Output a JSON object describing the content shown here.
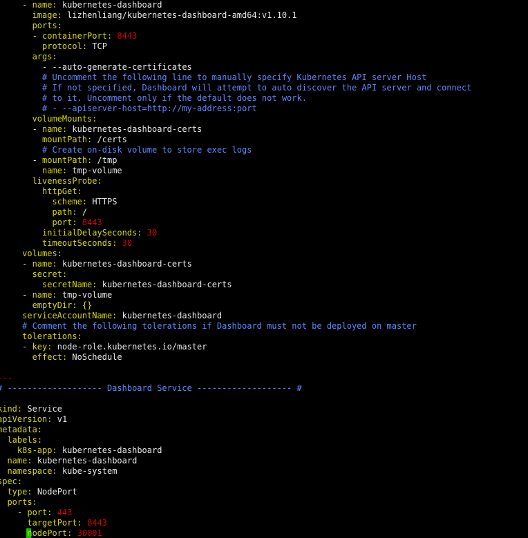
{
  "app": {
    "title": "Terminal - kubernetes-dashboard.yaml"
  },
  "colors": {
    "background": "#000000",
    "key": "#d7d700",
    "text": "#e8e8e8",
    "number": "#d70000",
    "comment": "#5f87ff",
    "cursor": "#00d700"
  },
  "editor": {
    "lines": [
      {
        "indent": "     ",
        "dash": "- ",
        "key": "name",
        "value": "kubernetes-dashboard",
        "type": "text"
      },
      {
        "indent": "       ",
        "key": "image",
        "value": "lizhenliang/kubernetes-dashboard-amd64:v1.10.1",
        "type": "text"
      },
      {
        "indent": "       ",
        "key": "ports",
        "value": "",
        "type": "text"
      },
      {
        "indent": "       ",
        "dash": "- ",
        "key": "containerPort",
        "value": "8443",
        "type": "num"
      },
      {
        "indent": "         ",
        "key": "protocol",
        "value": "TCP",
        "type": "text"
      },
      {
        "indent": "       ",
        "key": "args",
        "value": "",
        "type": "text"
      },
      {
        "indent": "         ",
        "dash": "- ",
        "value": "--auto-generate-certificates",
        "type": "text"
      },
      {
        "indent": "         ",
        "comment": "# Uncomment the following line to manually specify Kubernetes API server Host"
      },
      {
        "indent": "         ",
        "comment": "# If not specified, Dashboard will attempt to auto discover the API server and connect"
      },
      {
        "indent": "         ",
        "comment": "# to it. Uncomment only if the default does not work."
      },
      {
        "indent": "         ",
        "comment": "# - --apiserver-host=http://my-address:port"
      },
      {
        "indent": "       ",
        "key": "volumeMounts",
        "value": "",
        "type": "text"
      },
      {
        "indent": "       ",
        "dash": "- ",
        "key": "name",
        "value": "kubernetes-dashboard-certs",
        "type": "text"
      },
      {
        "indent": "         ",
        "key": "mountPath",
        "value": "/certs",
        "type": "text"
      },
      {
        "indent": "         ",
        "comment": "# Create on-disk volume to store exec logs"
      },
      {
        "indent": "       ",
        "dash": "- ",
        "key": "mountPath",
        "value": "/tmp",
        "type": "text"
      },
      {
        "indent": "         ",
        "key": "name",
        "value": "tmp-volume",
        "type": "text"
      },
      {
        "indent": "       ",
        "key": "livenessProbe",
        "value": "",
        "type": "text"
      },
      {
        "indent": "         ",
        "key": "httpGet",
        "value": "",
        "type": "text"
      },
      {
        "indent": "           ",
        "key": "scheme",
        "value": "HTTPS",
        "type": "text"
      },
      {
        "indent": "           ",
        "key": "path",
        "value": "/",
        "type": "text"
      },
      {
        "indent": "           ",
        "key": "port",
        "value": "8443",
        "type": "num"
      },
      {
        "indent": "         ",
        "key": "initialDelaySeconds",
        "value": "30",
        "type": "num"
      },
      {
        "indent": "         ",
        "key": "timeoutSeconds",
        "value": "30",
        "type": "num"
      },
      {
        "indent": "     ",
        "key": "volumes",
        "value": "",
        "type": "text"
      },
      {
        "indent": "     ",
        "dash": "- ",
        "key": "name",
        "value": "kubernetes-dashboard-certs",
        "type": "text"
      },
      {
        "indent": "       ",
        "key": "secret",
        "value": "",
        "type": "text"
      },
      {
        "indent": "         ",
        "key": "secretName",
        "value": "kubernetes-dashboard-certs",
        "type": "text"
      },
      {
        "indent": "     ",
        "dash": "- ",
        "key": "name",
        "value": "tmp-volume",
        "type": "text"
      },
      {
        "indent": "       ",
        "key": "emptyDir",
        "value": "{}",
        "type": "punct"
      },
      {
        "indent": "     ",
        "key": "serviceAccountName",
        "value": "kubernetes-dashboard",
        "type": "text"
      },
      {
        "indent": "     ",
        "comment": "# Comment the following tolerations if Dashboard must not be deployed on master"
      },
      {
        "indent": "     ",
        "key": "tolerations",
        "value": "",
        "type": "text"
      },
      {
        "indent": "     ",
        "dash": "- ",
        "key": "key",
        "value": "node-role.kubernetes.io/master",
        "type": "text"
      },
      {
        "indent": "       ",
        "key": "effect",
        "value": "NoSchedule",
        "type": "text"
      },
      {
        "indent": "",
        "blank": true
      },
      {
        "indent": "",
        "raw": "---",
        "type": "sep"
      },
      {
        "indent": "",
        "comment": "# ------------------- Dashboard Service ------------------- #"
      },
      {
        "indent": "",
        "blank": true
      },
      {
        "indent": "",
        "key": "kind",
        "value": "Service",
        "type": "text"
      },
      {
        "indent": "",
        "key": "apiVersion",
        "value": "v1",
        "type": "text"
      },
      {
        "indent": "",
        "key": "metadata",
        "value": "",
        "type": "text"
      },
      {
        "indent": "  ",
        "key": "labels",
        "value": "",
        "type": "text"
      },
      {
        "indent": "    ",
        "key": "k8s-app",
        "value": "kubernetes-dashboard",
        "type": "text"
      },
      {
        "indent": "  ",
        "key": "name",
        "value": "kubernetes-dashboard",
        "type": "text"
      },
      {
        "indent": "  ",
        "key": "namespace",
        "value": "kube-system",
        "type": "text"
      },
      {
        "indent": "",
        "key": "spec",
        "value": "",
        "type": "text"
      },
      {
        "indent": "  ",
        "key": "type",
        "value": "NodePort",
        "type": "text"
      },
      {
        "indent": "  ",
        "key": "ports",
        "value": "",
        "type": "text"
      },
      {
        "indent": "    ",
        "dash": "- ",
        "key": "port",
        "value": "443",
        "type": "num"
      },
      {
        "indent": "      ",
        "key": "targetPort",
        "value": "8443",
        "type": "num"
      },
      {
        "indent": "      ",
        "key": "nodePort",
        "value": "30001",
        "type": "num",
        "cursor": true
      }
    ]
  }
}
